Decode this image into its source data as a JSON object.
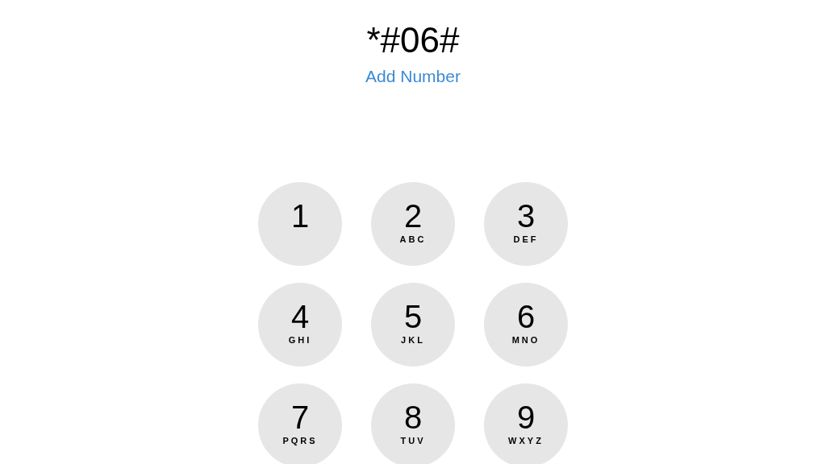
{
  "dialed_number": "*#06#",
  "add_number_link": "Add Number",
  "keypad": [
    {
      "digit": "1"
    },
    {
      "digit": "2",
      "letters": "ABC"
    },
    {
      "digit": "3",
      "letters": "DEF"
    },
    {
      "digit": "4",
      "letters": "GHI"
    },
    {
      "digit": "5",
      "letters": "JKL"
    },
    {
      "digit": "6",
      "letters": "MNO"
    },
    {
      "digit": "7",
      "letters": "PQRS"
    },
    {
      "digit": "8",
      "letters": "TUV"
    },
    {
      "digit": "9",
      "letters": "WXYZ"
    }
  ]
}
